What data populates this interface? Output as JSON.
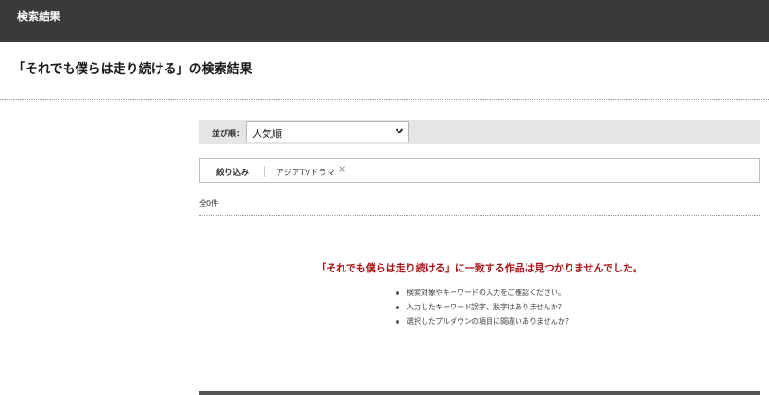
{
  "header": {
    "title": "検索結果"
  },
  "page": {
    "heading": "「それでも僕らは走り続ける」の検索結果"
  },
  "sort": {
    "label": "並び順：",
    "selected": "人気順",
    "icon": "chevron-down-icon"
  },
  "filter": {
    "label": "絞り込み",
    "chips": [
      {
        "label": "アジアTVドラマ",
        "remove_glyph": "×"
      }
    ]
  },
  "results": {
    "count_text": "全0件",
    "no_result_message": "「それでも僕らは走り続ける」に一致する作品は見つかりませんでした。",
    "tips": [
      "検索対象やキーワードの入力をご確認ください。",
      "入力したキーワード誤字、脱字はありませんか？",
      "選択したプルダウンの項目に間違いありませんか？"
    ]
  },
  "colors": {
    "header_bg": "#3a3a3a",
    "accent_red": "#a8161b",
    "bar_bg": "#e5e5e5"
  }
}
